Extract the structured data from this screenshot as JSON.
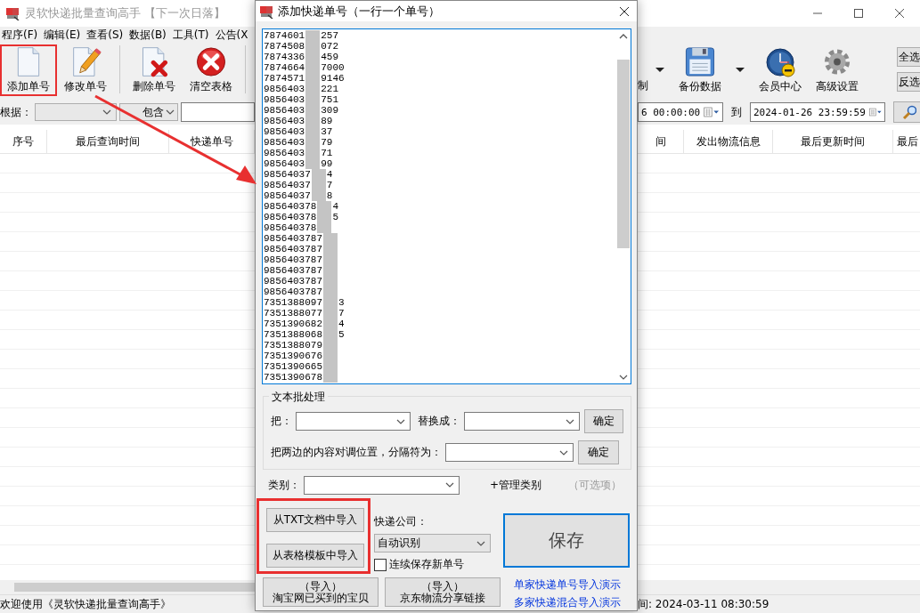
{
  "main_window": {
    "title": "灵软快递批量查询高手",
    "title_suffix": "【下一次日落】",
    "menu": [
      "程序(F)",
      "编辑(E)",
      "查看(S)",
      "数据(B)",
      "工具(T)",
      "公告(X"
    ],
    "toolbar_left": [
      {
        "kind": "new",
        "label": "添加单号",
        "highlighted": true
      },
      {
        "kind": "edit",
        "label": "修改单号",
        "highlighted": false
      },
      {
        "kind": "separator"
      },
      {
        "kind": "delete",
        "label": "删除单号",
        "highlighted": false
      },
      {
        "kind": "clear",
        "label": "清空表格",
        "highlighted": false
      },
      {
        "kind": "separator"
      }
    ],
    "toolbar_right": [
      {
        "kind": "partial",
        "label": "制"
      },
      {
        "kind": "caret"
      },
      {
        "kind": "backup",
        "label": "备份数据"
      },
      {
        "kind": "caret"
      },
      {
        "kind": "member",
        "label": "会员中心"
      },
      {
        "kind": "settings",
        "label": "高级设置"
      }
    ],
    "side_buttons": [
      "全选",
      "反选"
    ],
    "filter": {
      "label": "根据：",
      "match": "包含"
    },
    "date_range": {
      "start": "6 00:00:00",
      "separator": "到",
      "end": "2024-01-26 23:59:59"
    },
    "table": {
      "columns_left": [
        "序号",
        "最后查询时间",
        "快递单号"
      ],
      "columns_right": [
        "间",
        "发出物流信息",
        "最后更新时间",
        "最后"
      ]
    },
    "status_bar": {
      "message": "欢迎使用《灵软快递批量查询高手》",
      "time": "间: 2024-03-11 08:30:59"
    }
  },
  "dialog": {
    "title": "添加快递单号（一行一个单号）",
    "numbers": [
      {
        "start": "7874601",
        "end": "257"
      },
      {
        "start": "7874508",
        "end": "072"
      },
      {
        "start": "7874336",
        "end": "459"
      },
      {
        "start": "7874664",
        "end": "7000"
      },
      {
        "start": "7874571",
        "end": "9146"
      },
      {
        "start": "9856403",
        "end": "221"
      },
      {
        "start": "9856403",
        "end": "751"
      },
      {
        "start": "9856403",
        "end": "309"
      },
      {
        "start": "9856403",
        "end": "89"
      },
      {
        "start": "9856403",
        "end": "37"
      },
      {
        "start": "9856403",
        "end": "79"
      },
      {
        "start": "9856403",
        "end": "71"
      },
      {
        "start": "9856403",
        "end": "99"
      },
      {
        "start": "98564037",
        "end": "4"
      },
      {
        "start": "98564037",
        "end": "7"
      },
      {
        "start": "98564037",
        "end": "8"
      },
      {
        "start": "985640378",
        "end": "4"
      },
      {
        "start": "985640378",
        "end": "5"
      },
      {
        "start": "985640378"
      },
      {
        "start": "9856403787"
      },
      {
        "start": "9856403787"
      },
      {
        "start": "9856403787"
      },
      {
        "start": "9856403787"
      },
      {
        "start": "9856403787"
      },
      {
        "start": "9856403787"
      },
      {
        "start": "7351388097",
        "end": "3"
      },
      {
        "start": "7351388077",
        "end": "7"
      },
      {
        "start": "7351390682",
        "end": "4"
      },
      {
        "start": "7351388068",
        "end": "5"
      },
      {
        "start": "7351388079"
      },
      {
        "start": "7351390676"
      },
      {
        "start": "7351390665"
      },
      {
        "start": "7351390678"
      }
    ],
    "batch": {
      "title": "文本批处理",
      "replace_label": "把：",
      "with_label": "替换成：",
      "ok": "确定",
      "swap_label": "把两边的内容对调位置，分隔符为：",
      "swap_ok": "确定"
    },
    "category": {
      "label": "类别：",
      "manage": "+管理类别",
      "hint": "（可选项）"
    },
    "import_buttons": [
      "从TXT文档中导入",
      "从表格模板中导入"
    ],
    "import_highlighted": true,
    "courier": {
      "label": "快递公司：",
      "value": "自动识别"
    },
    "keep_saving": {
      "label": "连续保存新单号",
      "checked": false
    },
    "save": {
      "label": "保存",
      "focused": true
    },
    "online_imports": [
      {
        "line1": "（导入）",
        "line2": "淘宝网已买到的宝贝"
      },
      {
        "line1": "（导入）",
        "line2": "京东物流分享链接"
      }
    ],
    "demo_links": [
      "单家快递单号导入演示",
      "多家快递混合导入演示"
    ]
  }
}
